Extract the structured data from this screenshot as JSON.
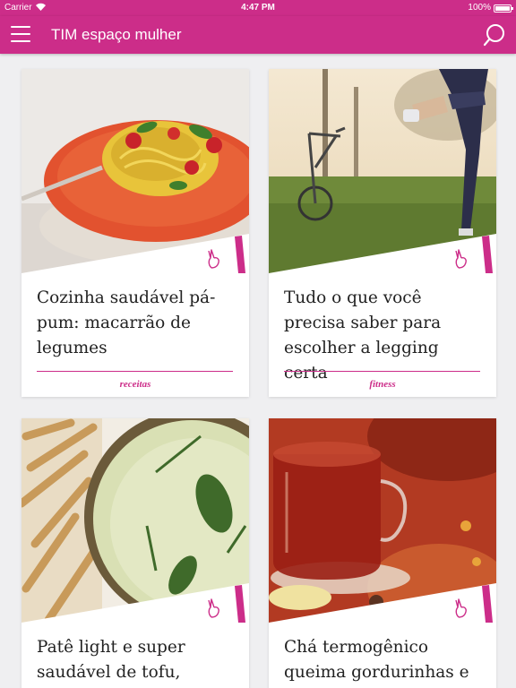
{
  "statusbar": {
    "carrier": "Carrier",
    "time": "4:47 PM",
    "battery": "100%"
  },
  "header": {
    "title": "TIM espaço mulher"
  },
  "colors": {
    "brand": "#cc2d89",
    "background": "#efeff1"
  },
  "icons": {
    "menu": "hamburger-icon",
    "search": "search-icon",
    "badge": "peace-hand-icon"
  },
  "articles": [
    {
      "title": "Cozinha saudável pá-pum: macarrão de legumes",
      "category": "receitas"
    },
    {
      "title": "Tudo o que você precisa saber para escolher a legging certa",
      "category": "fitness"
    },
    {
      "title": "Patê light e super saudável de tofu,",
      "category": ""
    },
    {
      "title": "Chá termogênico queima gordurinhas e",
      "category": ""
    }
  ]
}
